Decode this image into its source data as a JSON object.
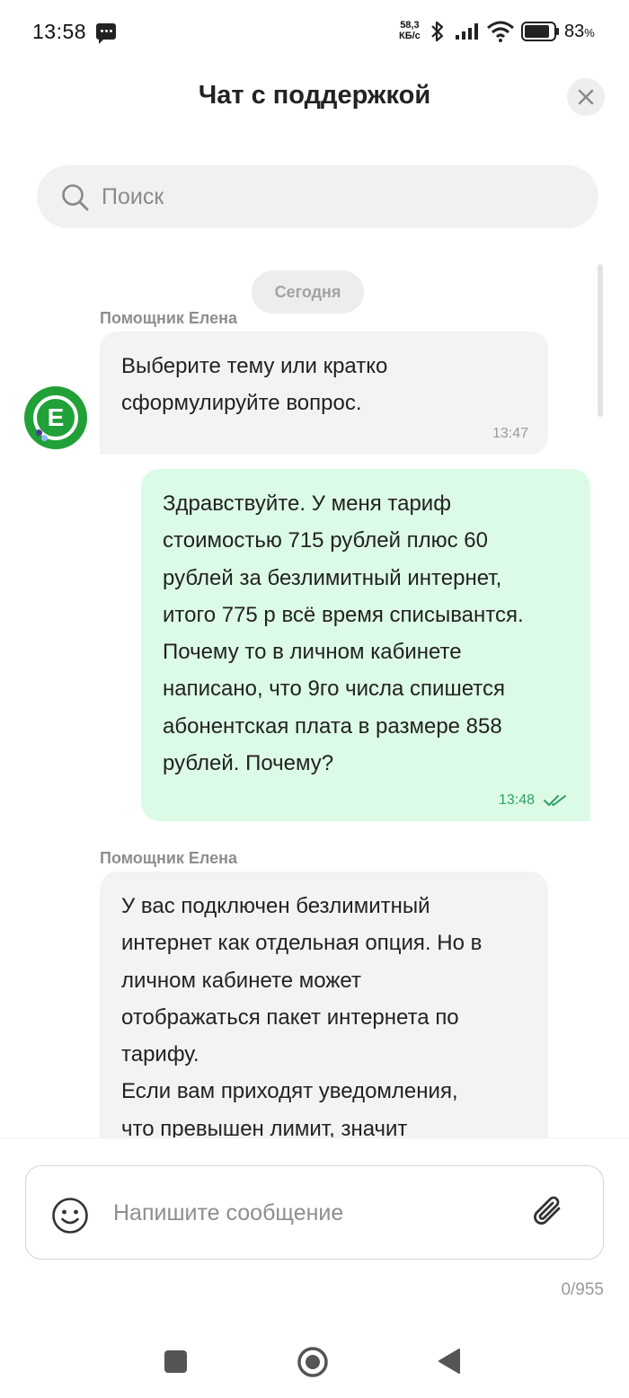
{
  "status_bar": {
    "time": "13:58",
    "net_speed_value": "58,3",
    "net_speed_unit": "КБ/с",
    "battery_percent": "83",
    "battery_percent_sign": "%"
  },
  "header": {
    "title": "Чат с поддержкой"
  },
  "search": {
    "placeholder": "Поиск"
  },
  "chat": {
    "date_label": "Сегодня",
    "messages": [
      {
        "sender": "Помощник Елена",
        "direction": "incoming",
        "text": "Выберите тему или кратко\nсформулируйте вопрос.",
        "time": "13:47",
        "avatar_letter": "E"
      },
      {
        "direction": "outgoing",
        "text": "Здравствуйте. У меня тариф\nстоимостью 715 рублей плюс 60\nрублей за безлимитный интернет,\nитого 775 р всё время списывантся.\nПочему то в личном кабинете\nнаписано, что 9го числа спишется\nабонентская плата в размере 858\nрублей. Почему?",
        "time": "13:48",
        "status": "read"
      },
      {
        "sender": "Помощник Елена",
        "direction": "incoming",
        "text": "У вас подключен безлимитный\nинтернет как отдельная опция. Но в\nличном кабинете может\nотображаться пакет интернета по\nтарифу.\nЕсли вам приходят уведомления,\nчто превышен лимит, значит"
      }
    ]
  },
  "composer": {
    "placeholder": "Напишите сообщение",
    "counter": "0/955"
  },
  "colors": {
    "brand_green": "#21a038",
    "outgoing_bubble": "#dcfbe6",
    "incoming_bubble": "#f3f3f3",
    "read_ticks": "#2ea163"
  }
}
